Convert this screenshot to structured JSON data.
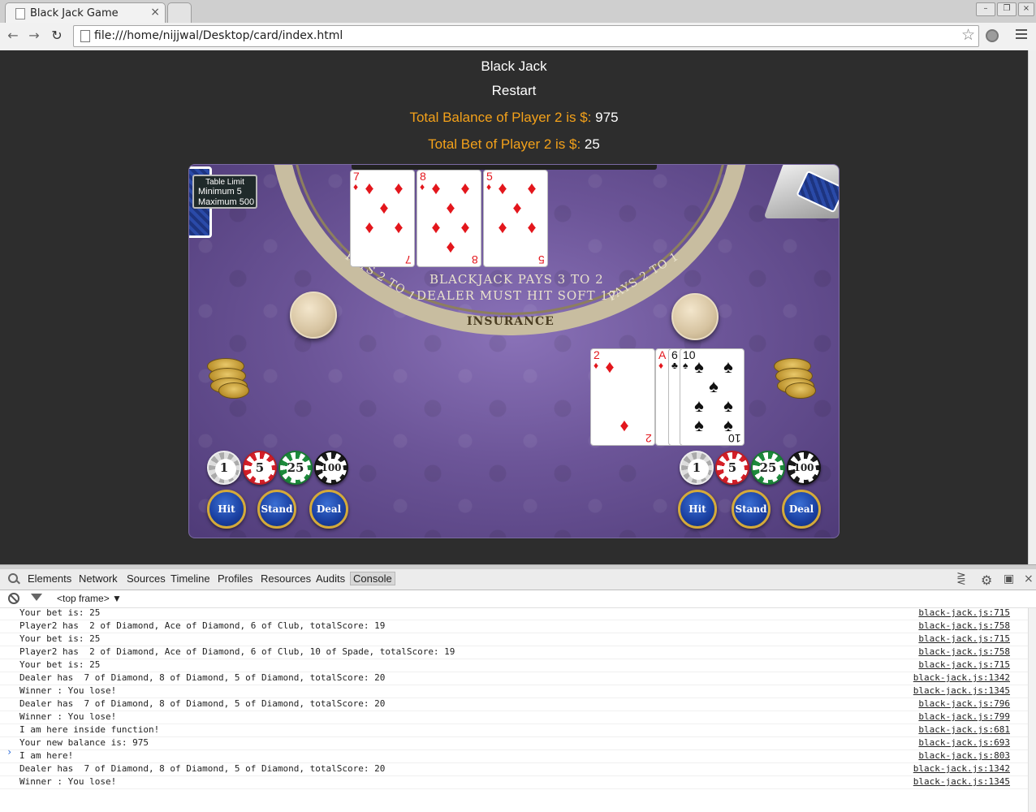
{
  "browser": {
    "tab_title": "Black Jack Game",
    "tab_close": "×",
    "url": "file:///home/nijjwal/Desktop/card/index.html"
  },
  "page": {
    "title": "Black Jack",
    "restart": "Restart",
    "balance_label": "Total Balance of Player 2 is $:",
    "balance_value": "975",
    "bet_label": "Total Bet of Player 2 is $:",
    "bet_value": "25"
  },
  "table": {
    "limit_title": "Table Limit",
    "limit_min": "Minimum 5",
    "limit_max": "Maximum 500",
    "arc_pays_left": "PAYS 2 TO 1",
    "arc_pays_right": "PAYS 2 TO 1",
    "arc_blackjack": "BLACKJACK PAYS 3 TO 2",
    "arc_dealer": "DEALER MUST HIT SOFT 17",
    "arc_insurance": "INSURANCE",
    "dealer_cards": [
      {
        "rank": "7",
        "suit": "♦",
        "color": "#e3161c"
      },
      {
        "rank": "8",
        "suit": "♦",
        "color": "#e3161c"
      },
      {
        "rank": "5",
        "suit": "♦",
        "color": "#e3161c"
      }
    ],
    "player_cards": [
      {
        "rank": "2",
        "suit": "♦",
        "color": "#e3161c"
      },
      {
        "rank": "A",
        "suit": "♦",
        "color": "#e3161c"
      },
      {
        "rank": "6",
        "suit": "♣",
        "color": "#111111"
      },
      {
        "rank": "10",
        "suit": "♠",
        "color": "#111111"
      }
    ],
    "chips": [
      "1",
      "5",
      "25",
      "100"
    ],
    "buttons": {
      "hit": "Hit",
      "stand": "Stand",
      "deal": "Deal"
    }
  },
  "devtools": {
    "tabs": [
      "Elements",
      "Network",
      "Sources",
      "Timeline",
      "Profiles",
      "Resources",
      "Audits",
      "Console"
    ],
    "active_tab": "Console",
    "frame": "<top frame>",
    "logs": [
      {
        "msg": "Your bet is: 25",
        "src": "black-jack.js:715"
      },
      {
        "msg": "Player2 has  2 of Diamond, Ace of Diamond, 6 of Club, totalScore: 19",
        "src": "black-jack.js:758"
      },
      {
        "msg": "Your bet is: 25",
        "src": "black-jack.js:715"
      },
      {
        "msg": "Player2 has  2 of Diamond, Ace of Diamond, 6 of Club, 10 of Spade, totalScore: 19",
        "src": "black-jack.js:758"
      },
      {
        "msg": "Your bet is: 25",
        "src": "black-jack.js:715"
      },
      {
        "msg": "Dealer has  7 of Diamond, 8 of Diamond, 5 of Diamond, totalScore: 20",
        "src": "black-jack.js:1342"
      },
      {
        "msg": "Winner : You lose!",
        "src": "black-jack.js:1345"
      },
      {
        "msg": "Dealer has  7 of Diamond, 8 of Diamond, 5 of Diamond, totalScore: 20",
        "src": "black-jack.js:796"
      },
      {
        "msg": "Winner : You lose!",
        "src": "black-jack.js:799"
      },
      {
        "msg": "I am here inside function!",
        "src": "black-jack.js:681"
      },
      {
        "msg": "Your new balance is: 975",
        "src": "black-jack.js:693"
      },
      {
        "msg": "I am here!",
        "src": "black-jack.js:803"
      },
      {
        "msg": "Dealer has  7 of Diamond, 8 of Diamond, 5 of Diamond, totalScore: 20",
        "src": "black-jack.js:1342"
      },
      {
        "msg": "Winner : You lose!",
        "src": "black-jack.js:1345"
      }
    ],
    "prompt": "›"
  }
}
